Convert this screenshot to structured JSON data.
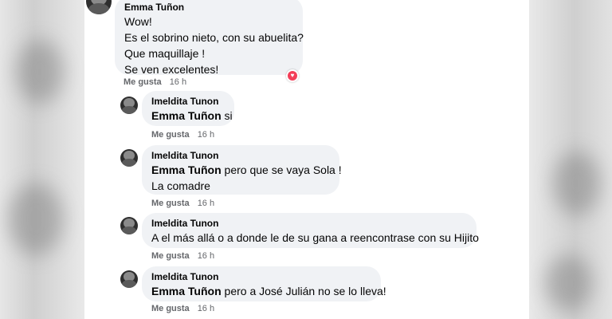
{
  "comments": [
    {
      "author": "Emma Tuñon",
      "lines": [
        "Wow!",
        "Es el sobrino nieto, con su abuelita?",
        "Que maquillaje !",
        "Se ven excelentes!"
      ],
      "like_label": "Me gusta",
      "time": "16 h",
      "reaction_icon": "heart-reaction-icon",
      "reaction_color": "#f33e58"
    }
  ],
  "replies": [
    {
      "author": "Imeldita Tunon",
      "mention": "Emma Tuñon",
      "lines": [
        "si"
      ],
      "like_label": "Me gusta",
      "time": "16 h"
    },
    {
      "author": "Imeldita Tunon",
      "mention": "Emma Tuñon",
      "lines": [
        "pero que se vaya Sola !",
        "La comadre"
      ],
      "like_label": "Me gusta",
      "time": "16 h"
    },
    {
      "author": "Imeldita Tunon",
      "mention": "",
      "lines": [
        "A el más allá o a donde le de su gana a reencontrase con su Hijito"
      ],
      "like_label": "Me gusta",
      "time": "16 h"
    },
    {
      "author": "Imeldita Tunon",
      "mention": "Emma Tuñon",
      "lines": [
        "pero a José Julián no se lo lleva!"
      ],
      "like_label": "Me gusta",
      "time": "16 h"
    }
  ]
}
